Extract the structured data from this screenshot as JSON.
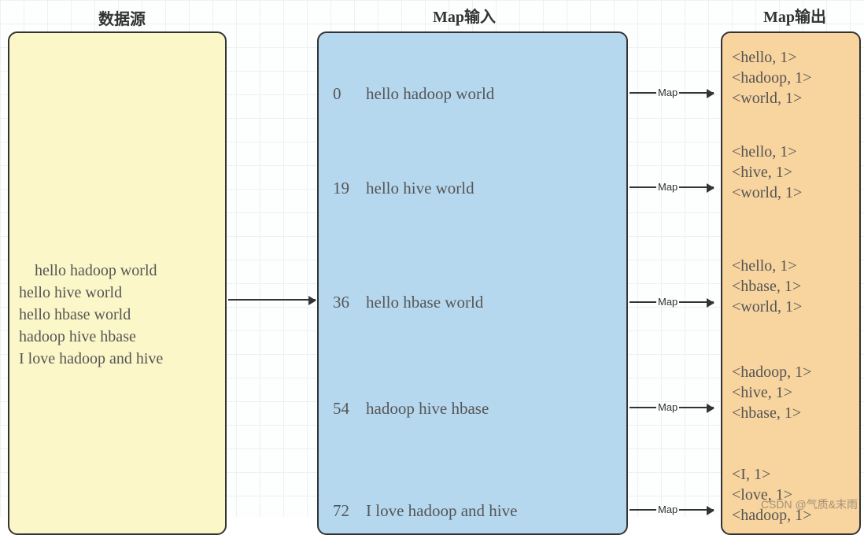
{
  "titles": {
    "source": "数据源",
    "map_input": "Map输入",
    "map_output": "Map输出"
  },
  "source_lines": [
    "hello hadoop world",
    "hello hive world",
    "hello hbase world",
    "hadoop hive hbase",
    "I love hadoop and hive"
  ],
  "map_input": [
    {
      "offset": "0",
      "text": "hello hadoop world"
    },
    {
      "offset": "19",
      "text": "hello hive world"
    },
    {
      "offset": "36",
      "text": "hello hbase world"
    },
    {
      "offset": "54",
      "text": "hadoop hive hbase"
    },
    {
      "offset": "72",
      "text": "I love hadoop and hive"
    }
  ],
  "map_output": [
    [
      "<hello, 1>",
      "<hadoop, 1>",
      "<world, 1>"
    ],
    [
      "<hello, 1>",
      "<hive, 1>",
      "<world, 1>"
    ],
    [
      "<hello, 1>",
      "<hbase, 1>",
      "<world, 1>"
    ],
    [
      "<hadoop, 1>",
      "<hive, 1>",
      "<hbase, 1>"
    ],
    [
      "<I, 1>",
      "<love, 1>",
      "<hadoop, 1>"
    ]
  ],
  "arrow_label": "Map",
  "watermark": "CSDN @气质&末雨"
}
